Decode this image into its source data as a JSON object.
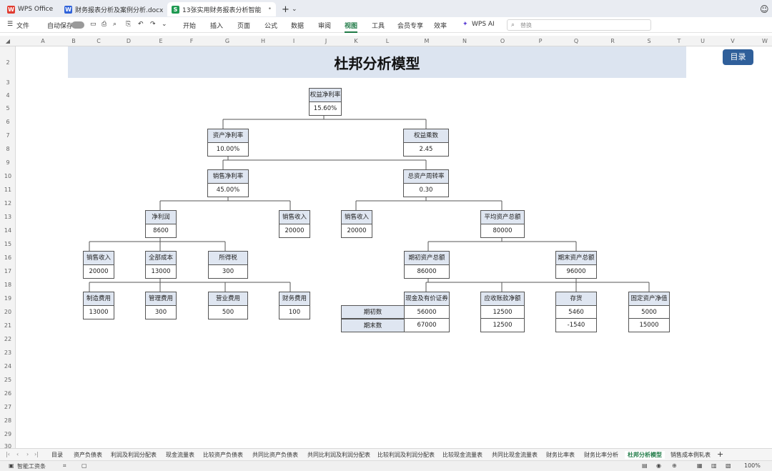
{
  "window_tabs": [
    {
      "label": "WPS Office",
      "icon": "W",
      "color": "#e03c31"
    },
    {
      "label": "财务报表分析及案例分析.docx",
      "icon": "W",
      "color": "#2f62d9"
    },
    {
      "label": "13张实用财务报表分析智能",
      "icon": "S",
      "color": "#1f9a52"
    }
  ],
  "ribbon": {
    "file": "文件",
    "autosave": "自动保存",
    "tabs": [
      "开始",
      "插入",
      "页面",
      "公式",
      "数据",
      "审阅",
      "视图",
      "工具",
      "会员专享",
      "效率",
      "WPS AI"
    ],
    "active_tab": "视图",
    "search_placeholder": "替换"
  },
  "columns": [
    "A",
    "B",
    "C",
    "D",
    "E",
    "F",
    "G",
    "H",
    "I",
    "J",
    "K",
    "L",
    "M",
    "N",
    "O",
    "P",
    "Q",
    "R",
    "S",
    "T",
    "U",
    "V",
    "W"
  ],
  "rows": [
    "2",
    "3",
    "4",
    "5",
    "6",
    "7",
    "8",
    "9",
    "10",
    "11",
    "12",
    "13",
    "14",
    "15",
    "16",
    "17",
    "18",
    "19",
    "20",
    "21",
    "22",
    "23",
    "24",
    "25",
    "26",
    "27",
    "28",
    "29",
    "30"
  ],
  "title": "杜邦分析模型",
  "toc_button": "目录",
  "nodes": {
    "roe": {
      "label": "权益净利率",
      "value": "15.60%"
    },
    "roa": {
      "label": "资产净利率",
      "value": "10.00%"
    },
    "em": {
      "label": "权益乘数",
      "value": "2.45"
    },
    "npm": {
      "label": "销售净利率",
      "value": "45.00%"
    },
    "tat": {
      "label": "总资产周转率",
      "value": "0.30"
    },
    "np": {
      "label": "净利润",
      "value": "8600"
    },
    "sales1": {
      "label": "销售收入",
      "value": "20000"
    },
    "sales2": {
      "label": "销售收入",
      "value": "20000"
    },
    "avg_assets": {
      "label": "平均资产总额",
      "value": "80000"
    },
    "sales3": {
      "label": "销售收入",
      "value": "20000"
    },
    "total_cost": {
      "label": "全部成本",
      "value": "13000"
    },
    "tax": {
      "label": "所得税",
      "value": "300"
    },
    "begin_assets": {
      "label": "期初资产总额",
      "value": "86000"
    },
    "end_assets": {
      "label": "期末资产总额",
      "value": "96000"
    },
    "mfg": {
      "label": "制造费用",
      "value": "13000"
    },
    "admin": {
      "label": "管理费用",
      "value": "300"
    },
    "selling": {
      "label": "营业费用",
      "value": "500"
    },
    "finance": {
      "label": "财务费用",
      "value": "100"
    }
  },
  "asset_table": {
    "row_labels": [
      "期初数",
      "期末数"
    ],
    "columns": [
      {
        "label": "现金及有价证券",
        "values": [
          "56000",
          "67000"
        ]
      },
      {
        "label": "应收账款净额",
        "values": [
          "12500",
          "12500"
        ]
      },
      {
        "label": "存货",
        "values": [
          "5460",
          "-1540"
        ]
      },
      {
        "label": "固定资产净值",
        "values": [
          "5000",
          "15000"
        ]
      }
    ]
  },
  "sheet_tabs": [
    "目录",
    "资产负债表",
    "利润及利润分配表",
    "现金流量表",
    "比较资产负债表",
    "共同比资产负债表",
    "共同比利润及利润分配表",
    "比较利润及利润分配表",
    "比较现金流量表",
    "共同比现金流量表",
    "财务比率表",
    "财务比率分析",
    "杜邦分析模型",
    "销售成本例轧表"
  ],
  "active_sheet": "杜邦分析模型",
  "status": {
    "left": "智能工资条",
    "zoom": "100%"
  }
}
